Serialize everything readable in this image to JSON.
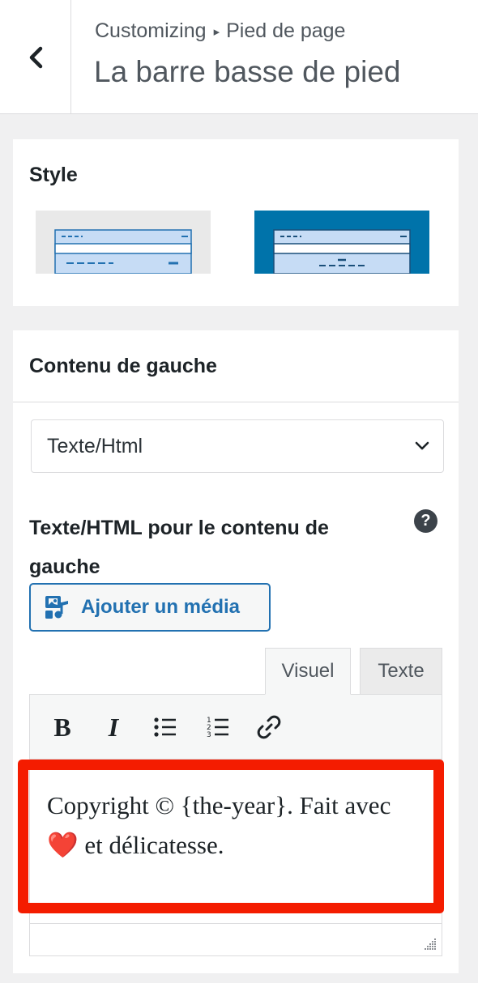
{
  "header": {
    "breadcrumb_root": "Customizing",
    "breadcrumb_separator": "▸",
    "breadcrumb_section": "Pied de page",
    "title": "La barre basse de pied",
    "back_icon": "chevron-left-icon"
  },
  "style_section": {
    "heading": "Style",
    "options": [
      {
        "name": "light-layout",
        "background": "#e9e9e9"
      },
      {
        "name": "dark-layout",
        "background": "#0073aa",
        "selected": true
      }
    ]
  },
  "content_section": {
    "heading": "Contenu de gauche",
    "select_value": "Texte/Html",
    "field_label": "Texte/HTML pour le contenu de gauche",
    "help_icon": "?",
    "media_button": "Ajouter un média",
    "tabs": [
      {
        "label": "Visuel",
        "active": true
      },
      {
        "label": "Texte",
        "active": false
      }
    ],
    "toolbar": [
      "bold",
      "italic",
      "bullet-list",
      "numbered-list",
      "link"
    ],
    "toolbar_bold": "B",
    "toolbar_italic": "I",
    "editor_text": "Copyright © {the-year}. Fait avec ❤️ et délicatesse."
  },
  "colors": {
    "accent": "#2271b1",
    "highlight": "#f41c00"
  }
}
